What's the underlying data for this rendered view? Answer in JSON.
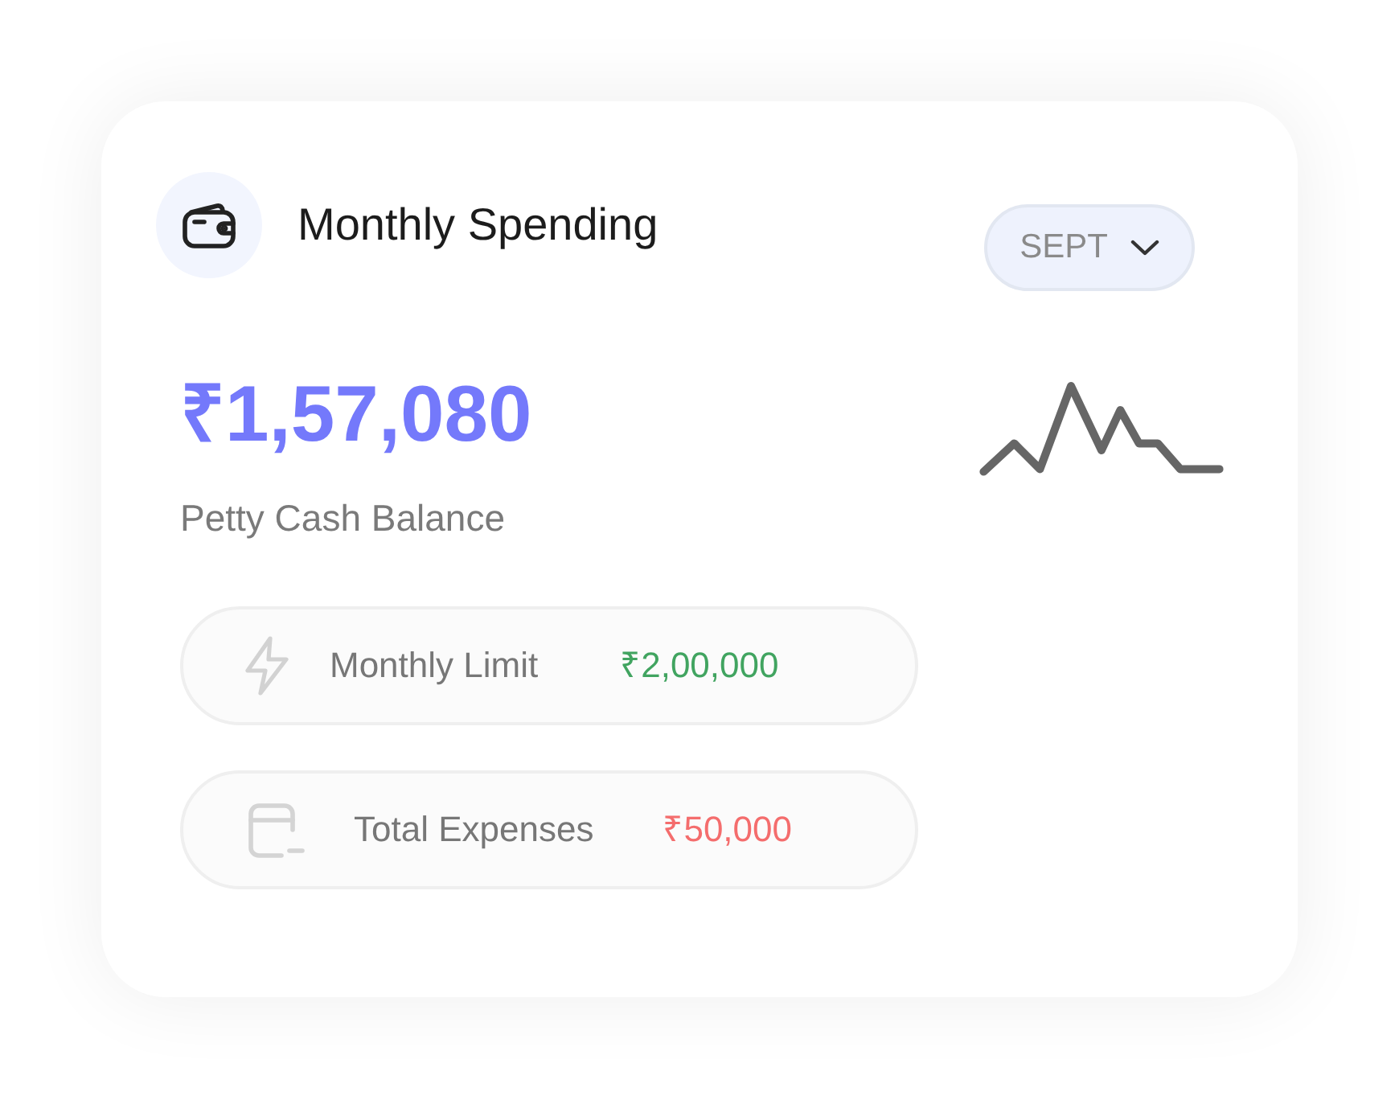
{
  "header": {
    "title": "Monthly Spending"
  },
  "month_selector": {
    "value": "SEPT"
  },
  "balance": {
    "amount": "₹1,57,080",
    "label": "Petty Cash Balance"
  },
  "stats": [
    {
      "kind": "limit",
      "label": "Monthly Limit",
      "value": "₹2,00,000",
      "color": "#41a460"
    },
    {
      "kind": "expenses",
      "label": "Total Expenses",
      "value": "₹50,000",
      "color": "#f46d6d"
    }
  ]
}
